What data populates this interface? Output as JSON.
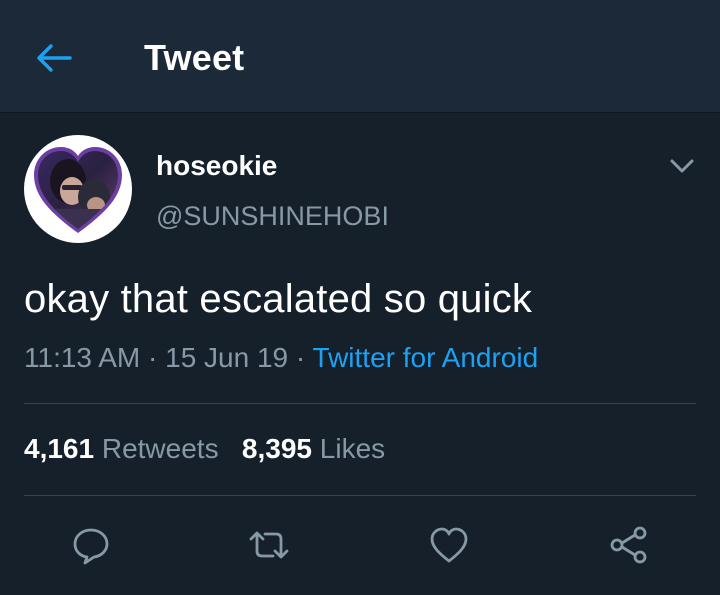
{
  "header": {
    "back_icon": "arrow-left-icon",
    "title": "Tweet"
  },
  "tweet": {
    "avatar_icon": "heart-avatar",
    "display_name": "hoseokie",
    "handle": "@SUNSHINEHOBI",
    "caret_icon": "chevron-down-icon",
    "text": "okay that escalated so quick",
    "time": "11:13 AM",
    "separator": "·",
    "date": "15 Jun 19",
    "source": "Twitter for Android"
  },
  "stats": {
    "retweets_count": "4,161",
    "retweets_label": "Retweets",
    "likes_count": "8,395",
    "likes_label": "Likes"
  },
  "actions": {
    "reply_icon": "reply-icon",
    "retweet_icon": "retweet-icon",
    "like_icon": "heart-icon",
    "share_icon": "share-icon"
  },
  "colors": {
    "background": "#15202b",
    "header_bg": "#1c2938",
    "accent": "#1da1f2",
    "muted": "#8899a6",
    "divider": "#38444d"
  }
}
